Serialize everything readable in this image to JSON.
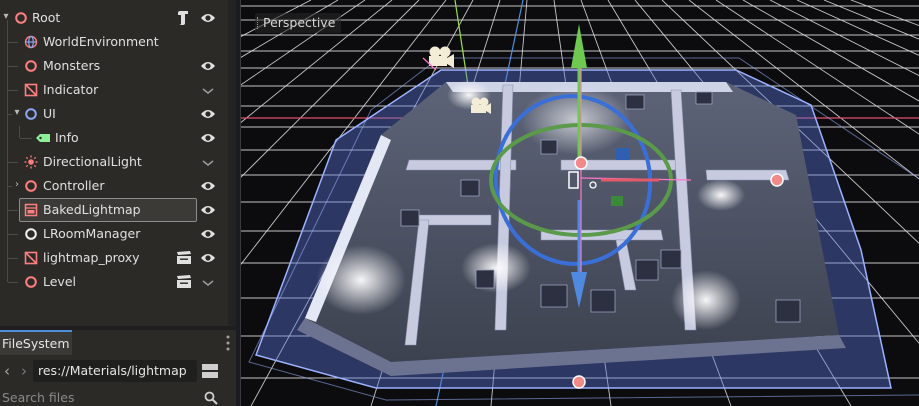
{
  "scene_tree": {
    "nodes": [
      {
        "label": "Root",
        "icon": "node3d-icon",
        "extra": "script-icon",
        "state": "eye-icon"
      },
      {
        "label": "WorldEnvironment",
        "icon": "world-environment-icon",
        "state": ""
      },
      {
        "label": "Monsters",
        "icon": "node3d-icon",
        "state": "eye-icon"
      },
      {
        "label": "Indicator",
        "icon": "cross-box-icon",
        "state": "chevron-down-icon"
      },
      {
        "label": "UI",
        "icon": "control-icon",
        "state": "eye-icon"
      },
      {
        "label": "Info",
        "icon": "label-icon",
        "state": "eye-icon"
      },
      {
        "label": "DirectionalLight",
        "icon": "directional-light-icon",
        "state": "chevron-down-icon"
      },
      {
        "label": "Controller",
        "icon": "node3d-icon",
        "state": "eye-icon"
      },
      {
        "label": "BakedLightmap",
        "icon": "baked-lightmap-icon",
        "state": "eye-icon",
        "selected": true
      },
      {
        "label": "LRoomManager",
        "icon": "room-manager-icon",
        "state": "eye-icon"
      },
      {
        "label": "lightmap_proxy",
        "icon": "cross-box-icon",
        "extra": "clapperboard-icon",
        "state": "eye-icon"
      },
      {
        "label": "Level",
        "icon": "node3d-icon",
        "extra": "clapperboard-icon",
        "state": "chevron-down-icon"
      }
    ]
  },
  "filesystem": {
    "tab_label": "FileSystem",
    "path": "res://Materials/lightmap",
    "search_placeholder": "Search files"
  },
  "viewport": {
    "mode_label": "Perspective"
  },
  "colors": {
    "node3d": "#fc7f7f",
    "control": "#8da5f3",
    "label": "#8eef97",
    "accent": "#4f8edc"
  }
}
